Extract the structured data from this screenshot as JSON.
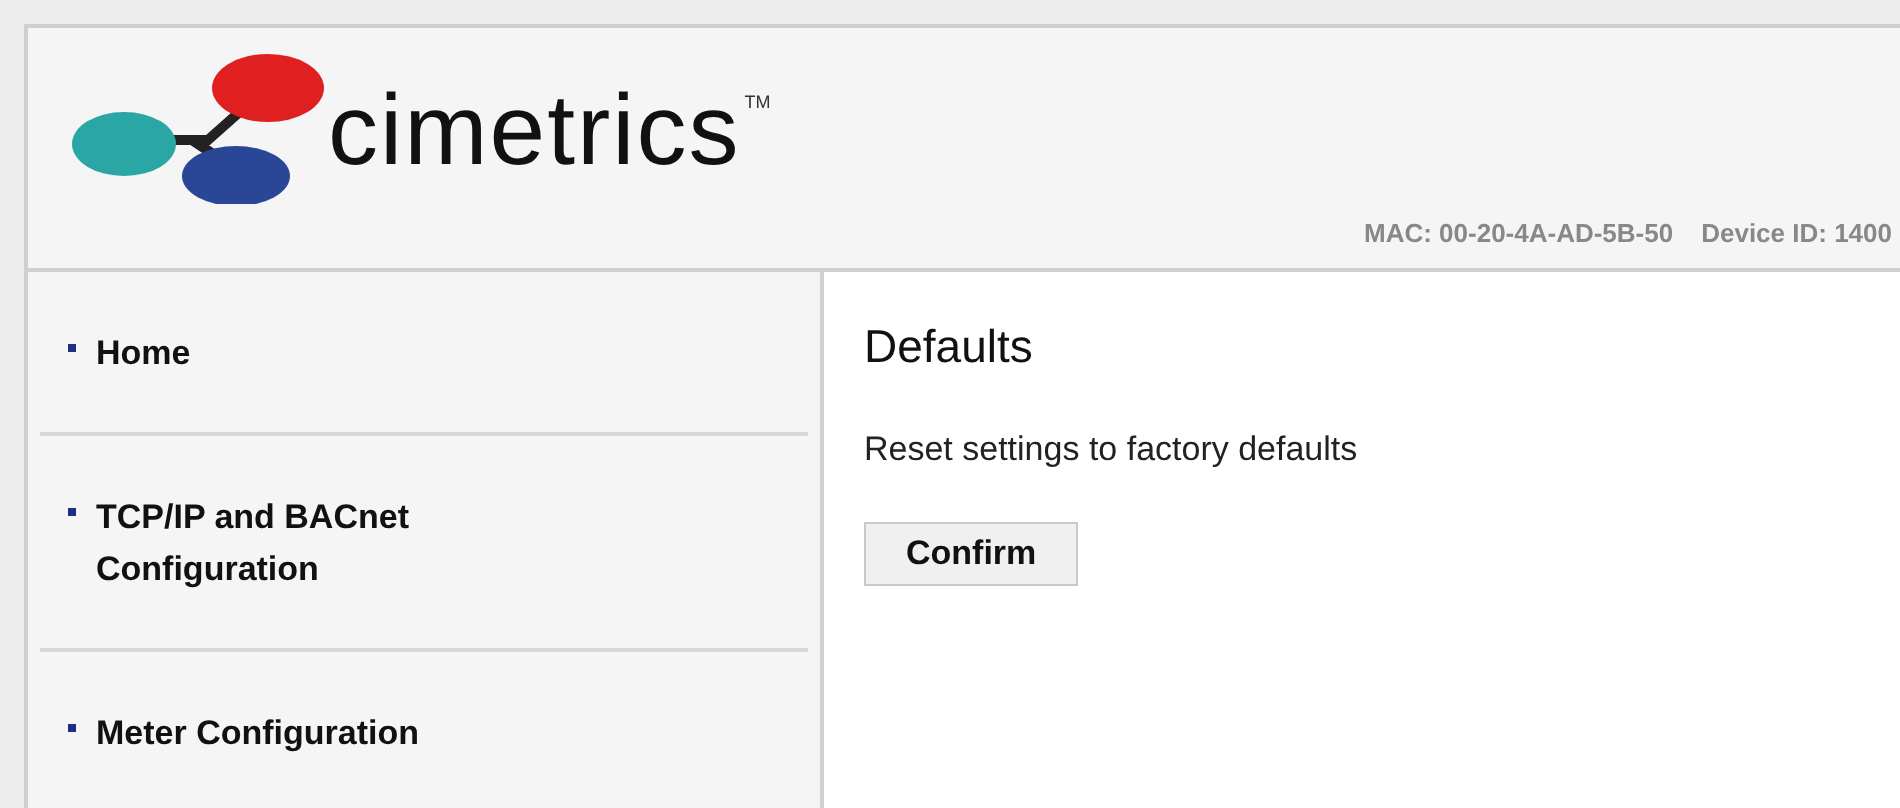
{
  "header": {
    "brand": "cimetrics",
    "trademark": "TM",
    "mac": "MAC: 00-20-4A-AD-5B-50",
    "device_id": "Device ID: 1400"
  },
  "sidebar": {
    "items": [
      {
        "label": "Home"
      },
      {
        "label": "TCP/IP and BACnet Configuration"
      },
      {
        "label": "Meter Configuration"
      }
    ]
  },
  "content": {
    "title": "Defaults",
    "description": "Reset settings to factory defaults",
    "button": "Confirm"
  }
}
